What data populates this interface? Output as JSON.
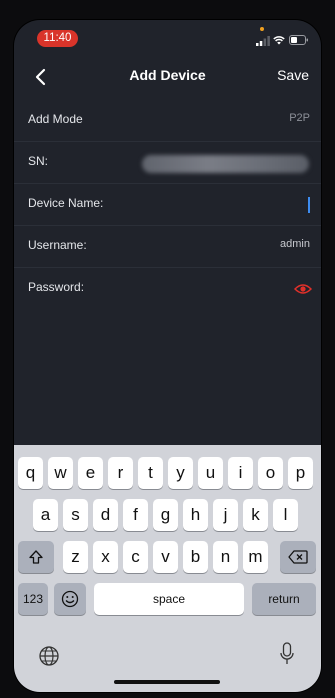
{
  "status_bar": {
    "time": "11:40"
  },
  "nav": {
    "title": "Add Device",
    "save_label": "Save"
  },
  "form": {
    "add_mode": {
      "label": "Add Mode",
      "value": "P2P"
    },
    "sn": {
      "label": "SN:"
    },
    "device_name": {
      "label": "Device Name:"
    },
    "username": {
      "label": "Username:",
      "value": "admin"
    },
    "password": {
      "label": "Password:"
    }
  },
  "keyboard": {
    "row1": [
      "q",
      "w",
      "e",
      "r",
      "t",
      "y",
      "u",
      "i",
      "o",
      "p"
    ],
    "row2": [
      "a",
      "s",
      "d",
      "f",
      "g",
      "h",
      "j",
      "k",
      "l"
    ],
    "row3": [
      "z",
      "x",
      "c",
      "v",
      "b",
      "n",
      "m"
    ],
    "numbers_label": "123",
    "space_label": "space",
    "return_label": "return"
  },
  "colors": {
    "time_pill": "#d9342a",
    "background": "#20232b",
    "cursor": "#3d8cf0",
    "eye_icon": "#e0302a",
    "keyboard_bg": "#d1d3d9"
  }
}
